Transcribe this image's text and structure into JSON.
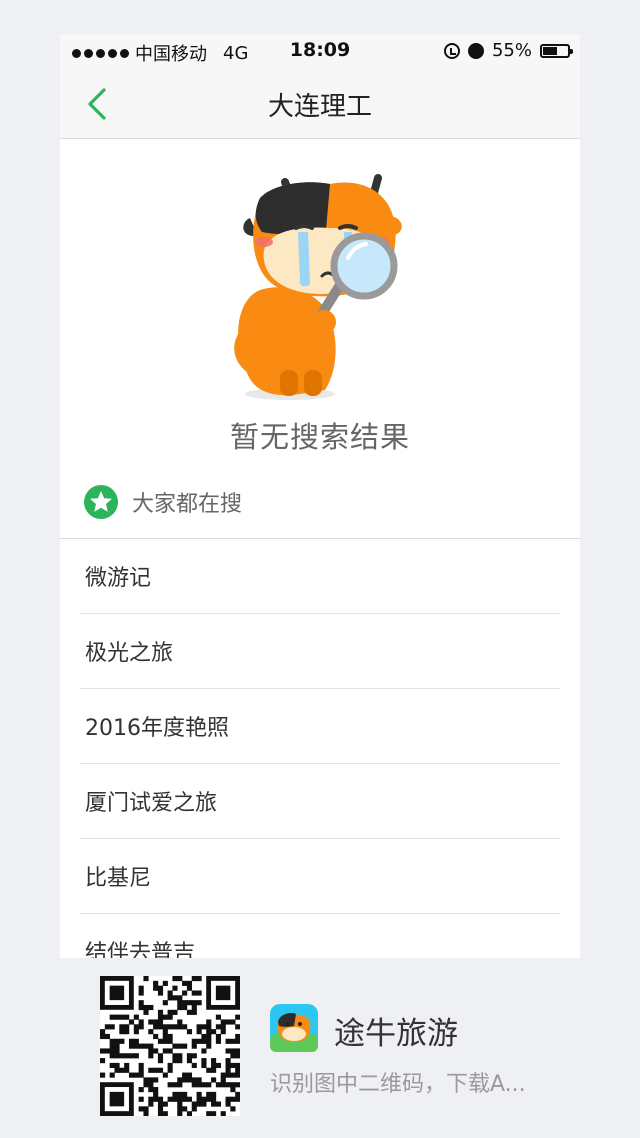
{
  "status_bar": {
    "carrier": "中国移动",
    "network": "4G",
    "time": "18:09",
    "battery": "55%",
    "battery_level": 0.55
  },
  "nav": {
    "title": "大连理工",
    "back_icon": "chevron-left-icon"
  },
  "empty_state": {
    "illustration": "crying-cow-with-magnifier",
    "text": "暂无搜索结果"
  },
  "hot_searches": {
    "icon": "star-icon",
    "label": "大家都在搜",
    "items": [
      "微游记",
      "极光之旅",
      "2016年度艳照",
      "厦门试爱之旅",
      "比基尼",
      "结伴去普吉"
    ]
  },
  "footer": {
    "qr": "qr-code",
    "app_name": "途牛旅游",
    "app_desc": "识别图中二维码，下载A..."
  },
  "colors": {
    "accent": "#2bb45a",
    "mascot_orange": "#f98a12",
    "background": "#eff0f4"
  }
}
